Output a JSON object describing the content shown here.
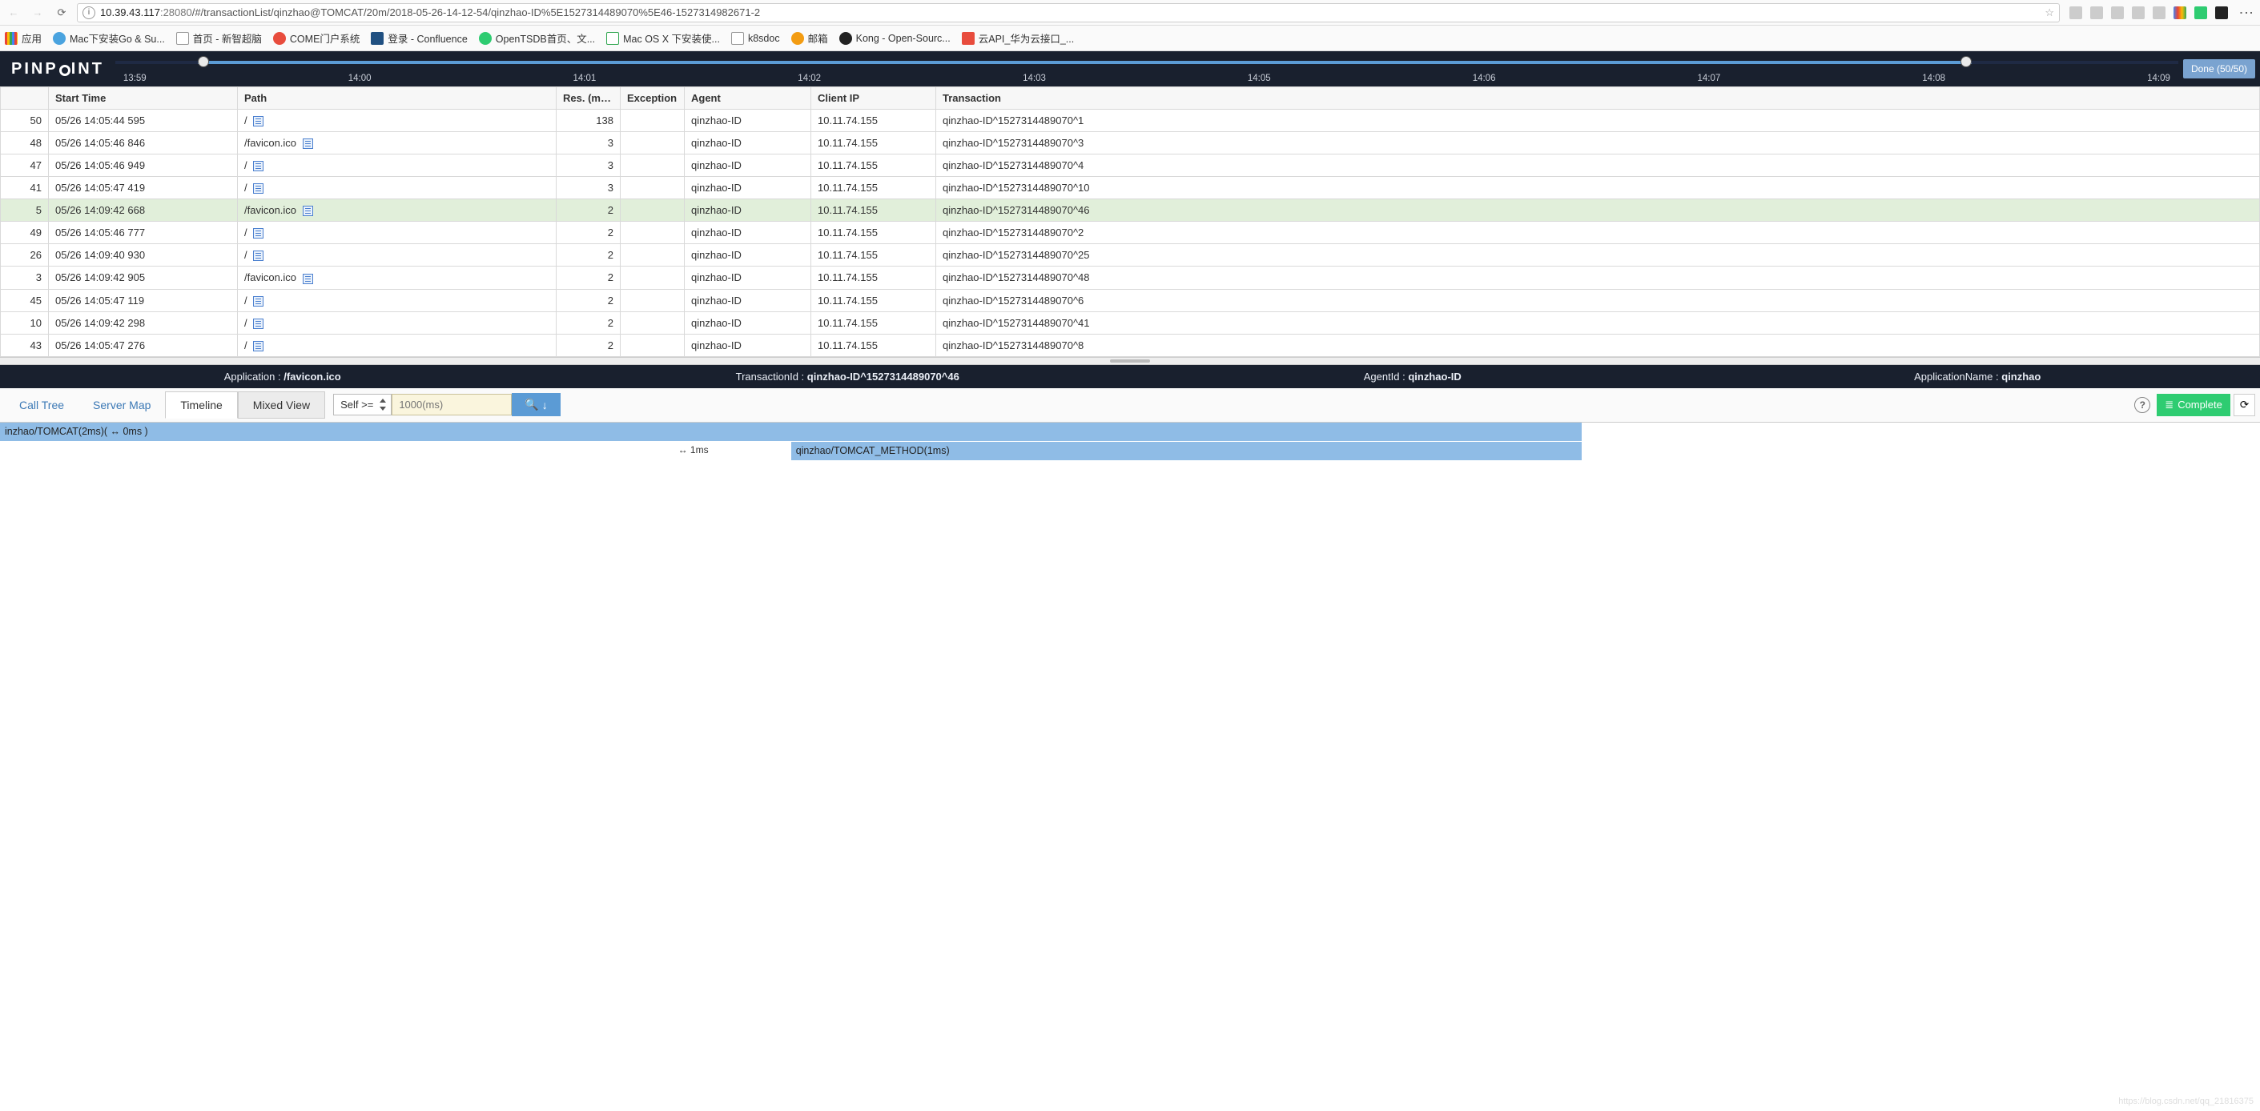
{
  "browser": {
    "url_host": "10.39.43.117",
    "url_port": ":28080",
    "url_path": "/#/transactionList/qinzhao@TOMCAT/20m/2018-05-26-14-12-54/qinzhao-ID%5E1527314489070%5E46-1527314982671-2"
  },
  "bookmarks": {
    "apps": "应用",
    "items": [
      "Mac下安装Go & Su...",
      "首页 - 新智超脑",
      "COME门户系统",
      "登录 - Confluence",
      "OpenTSDB首页、文...",
      "Mac OS X 下安装使...",
      "k8sdoc",
      "邮箱",
      "Kong - Open-Sourc...",
      "云API_华为云接口_..."
    ]
  },
  "logo_text_a": "PINP",
  "logo_text_b": "INT",
  "done_badge": "Done (50/50)",
  "ticks": [
    "13:59",
    "14:00",
    "14:01",
    "14:02",
    "14:03",
    "14:05",
    "14:06",
    "14:07",
    "14:08",
    "14:09"
  ],
  "columns": {
    "idx": "",
    "start": "Start Time",
    "path": "Path",
    "res": "Res. (ms)",
    "ex": "Exception",
    "agent": "Agent",
    "ip": "Client IP",
    "tx": "Transaction"
  },
  "rows": [
    {
      "idx": 50,
      "start": "05/26 14:05:44 595",
      "path": "/",
      "res": 138,
      "ex": "",
      "agent": "qinzhao-ID",
      "ip": "10.11.74.155",
      "tx": "qinzhao-ID^1527314489070^1",
      "sel": false
    },
    {
      "idx": 48,
      "start": "05/26 14:05:46 846",
      "path": "/favicon.ico",
      "res": 3,
      "ex": "",
      "agent": "qinzhao-ID",
      "ip": "10.11.74.155",
      "tx": "qinzhao-ID^1527314489070^3",
      "sel": false
    },
    {
      "idx": 47,
      "start": "05/26 14:05:46 949",
      "path": "/",
      "res": 3,
      "ex": "",
      "agent": "qinzhao-ID",
      "ip": "10.11.74.155",
      "tx": "qinzhao-ID^1527314489070^4",
      "sel": false
    },
    {
      "idx": 41,
      "start": "05/26 14:05:47 419",
      "path": "/",
      "res": 3,
      "ex": "",
      "agent": "qinzhao-ID",
      "ip": "10.11.74.155",
      "tx": "qinzhao-ID^1527314489070^10",
      "sel": false
    },
    {
      "idx": 5,
      "start": "05/26 14:09:42 668",
      "path": "/favicon.ico",
      "res": 2,
      "ex": "",
      "agent": "qinzhao-ID",
      "ip": "10.11.74.155",
      "tx": "qinzhao-ID^1527314489070^46",
      "sel": true
    },
    {
      "idx": 49,
      "start": "05/26 14:05:46 777",
      "path": "/",
      "res": 2,
      "ex": "",
      "agent": "qinzhao-ID",
      "ip": "10.11.74.155",
      "tx": "qinzhao-ID^1527314489070^2",
      "sel": false
    },
    {
      "idx": 26,
      "start": "05/26 14:09:40 930",
      "path": "/",
      "res": 2,
      "ex": "",
      "agent": "qinzhao-ID",
      "ip": "10.11.74.155",
      "tx": "qinzhao-ID^1527314489070^25",
      "sel": false
    },
    {
      "idx": 3,
      "start": "05/26 14:09:42 905",
      "path": "/favicon.ico",
      "res": 2,
      "ex": "",
      "agent": "qinzhao-ID",
      "ip": "10.11.74.155",
      "tx": "qinzhao-ID^1527314489070^48",
      "sel": false
    },
    {
      "idx": 45,
      "start": "05/26 14:05:47 119",
      "path": "/",
      "res": 2,
      "ex": "",
      "agent": "qinzhao-ID",
      "ip": "10.11.74.155",
      "tx": "qinzhao-ID^1527314489070^6",
      "sel": false
    },
    {
      "idx": 10,
      "start": "05/26 14:09:42 298",
      "path": "/",
      "res": 2,
      "ex": "",
      "agent": "qinzhao-ID",
      "ip": "10.11.74.155",
      "tx": "qinzhao-ID^1527314489070^41",
      "sel": false
    },
    {
      "idx": 43,
      "start": "05/26 14:05:47 276",
      "path": "/",
      "res": 2,
      "ex": "",
      "agent": "qinzhao-ID",
      "ip": "10.11.74.155",
      "tx": "qinzhao-ID^1527314489070^8",
      "sel": false
    }
  ],
  "detail": {
    "app_label": "Application : ",
    "app": "/favicon.ico",
    "txid_label": "TransactionId : ",
    "txid": "qinzhao-ID^1527314489070^46",
    "agent_label": "AgentId : ",
    "agent": "qinzhao-ID",
    "an_label": "ApplicationName : ",
    "an": "qinzhao"
  },
  "tabs": {
    "calltree": "Call Tree",
    "servermap": "Server Map",
    "timeline": "Timeline",
    "mixed": "Mixed View",
    "filter_sel": "Self >=",
    "filter_ph": "1000(ms)",
    "complete": "Complete"
  },
  "gantt": {
    "bar1": "inzhao/TOMCAT(2ms)(  ↔ 0ms  )",
    "scale": "↔ 1ms",
    "bar2": "qinzhao/TOMCAT_METHOD(1ms)"
  },
  "watermark": "https://blog.csdn.net/qq_21816375"
}
